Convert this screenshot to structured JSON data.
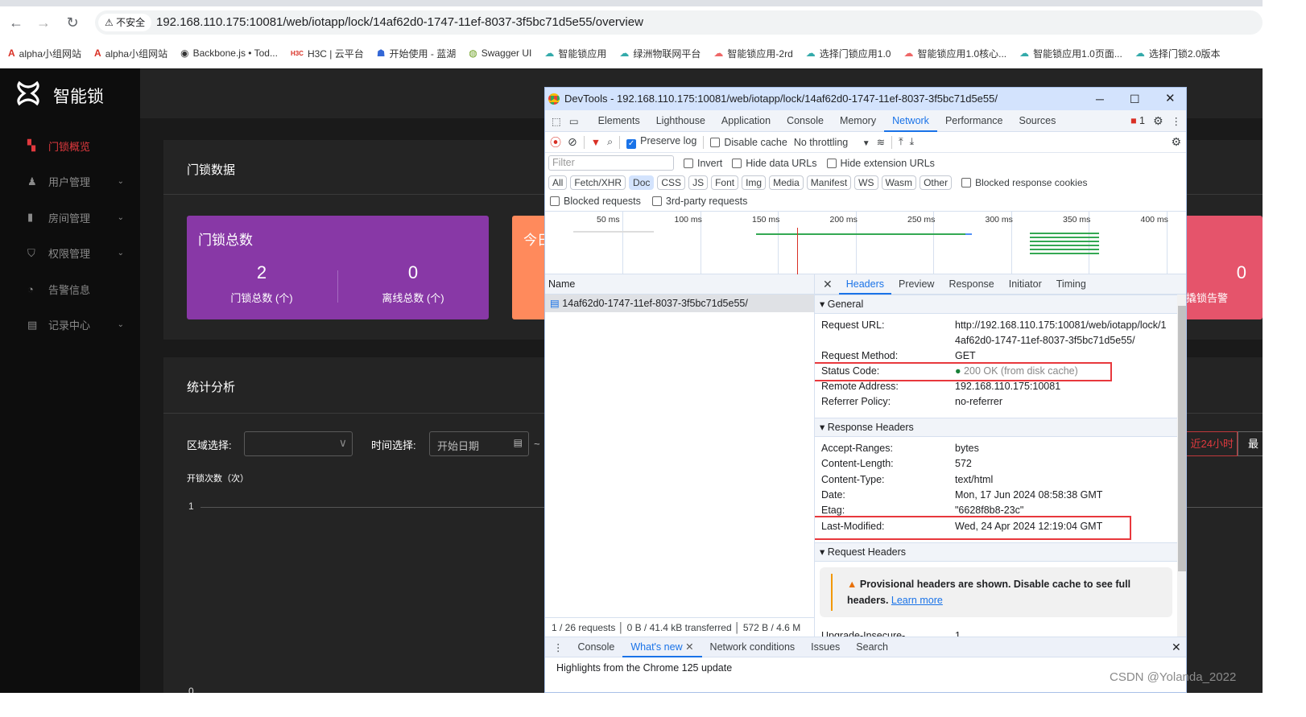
{
  "browser": {
    "insecure_label": "不安全",
    "url": "192.168.110.175:10081/web/iotapp/lock/14af62d0-1747-11ef-8037-3f5bc71d5e55/overview",
    "bookmarks": [
      "alpha小组网站",
      "alpha小组网站",
      "Backbone.js • Tod...",
      "H3C | 云平台",
      "开始使用 - 蓝湖",
      "Swagger UI",
      "智能锁应用",
      "绿洲物联网平台",
      "智能锁应用-2rd",
      "选择门锁应用1.0",
      "智能锁应用1.0核心...",
      "智能锁应用1.0页面...",
      "选择门锁2.0版本"
    ]
  },
  "app": {
    "name": "智能锁",
    "sidebar": [
      {
        "label": "门锁概览",
        "icon": "dashboard-icon",
        "active": true
      },
      {
        "label": "用户管理",
        "icon": "user-icon",
        "expandable": true
      },
      {
        "label": "房间管理",
        "icon": "door-icon",
        "expandable": true
      },
      {
        "label": "权限管理",
        "icon": "shield-icon",
        "expandable": true
      },
      {
        "label": "告警信息",
        "icon": "gauge-icon"
      },
      {
        "label": "记录中心",
        "icon": "document-icon",
        "expandable": true
      }
    ],
    "lock_data": {
      "title": "门锁数据",
      "card_title": "门锁总数",
      "total": "2",
      "total_label": "门锁总数 (个)",
      "offline": "0",
      "offline_label": "离线总数 (个)",
      "orange_card_title": "今日",
      "red_value": "0",
      "red_label": "撬锁告警"
    },
    "stats": {
      "title": "统计分析",
      "region_label": "区域选择:",
      "region_value": "",
      "time_label": "时间选择:",
      "start_placeholder": "开始日期",
      "range_sep": "~",
      "btn_24h": "近24小时",
      "btn_recent": "最",
      "chart_ylabel": "开锁次数（次）",
      "tick_1": "1",
      "tick_0": "0"
    },
    "colors": {
      "purple": "#8838a6",
      "orange": "#ff8a5c",
      "red": "#e5546b",
      "accent": "#e0393e"
    }
  },
  "devtools": {
    "title": "DevTools - 192.168.110.175:10081/web/iotapp/lock/14af62d0-1747-11ef-8037-3f5bc71d5e55/",
    "tabs": [
      "Elements",
      "Lighthouse",
      "Application",
      "Console",
      "Memory",
      "Network",
      "Performance",
      "Sources"
    ],
    "selected_tab": "Network",
    "issues_count": "1",
    "toolbar": {
      "preserve_log": "Preserve log",
      "preserve_log_checked": true,
      "disable_cache": "Disable cache",
      "throttling": "No throttling"
    },
    "filter": {
      "placeholder": "Filter",
      "invert": "Invert",
      "hide_data_urls": "Hide data URLs",
      "hide_ext_urls": "Hide extension URLs"
    },
    "types": [
      "All",
      "Fetch/XHR",
      "Doc",
      "CSS",
      "JS",
      "Font",
      "Img",
      "Media",
      "Manifest",
      "WS",
      "Wasm",
      "Other"
    ],
    "selected_type": "Doc",
    "blocked_cookies": "Blocked response cookies",
    "blocked_requests": "Blocked requests",
    "third_party": "3rd-party requests",
    "timeline_ticks": [
      "50 ms",
      "100 ms",
      "150 ms",
      "200 ms",
      "250 ms",
      "300 ms",
      "350 ms",
      "400 ms"
    ],
    "name_header": "Name",
    "request_name": "14af62d0-1747-11ef-8037-3f5bc71d5e55/",
    "footer": {
      "requests": "1 / 26 requests",
      "transferred": "0 B / 41.4 kB transferred",
      "resources": "572 B / 4.6 M"
    },
    "detail_tabs": [
      "Headers",
      "Preview",
      "Response",
      "Initiator",
      "Timing"
    ],
    "general": {
      "title": "General",
      "rows": [
        [
          "Request URL:",
          "http://192.168.110.175:10081/web/iotapp/lock/14af62d0-1747-11ef-8037-3f5bc71d5e55/"
        ],
        [
          "Request Method:",
          "GET"
        ],
        [
          "Status Code:",
          "200 OK (from disk cache)"
        ],
        [
          "Remote Address:",
          "192.168.110.175:10081"
        ],
        [
          "Referrer Policy:",
          "no-referrer"
        ]
      ]
    },
    "url_line1": "http://192.168.110.175:10081/web/iotapp/lock/1",
    "url_line2": "4af62d0-1747-11ef-8037-3f5bc71d5e55/",
    "response_headers": {
      "title": "Response Headers",
      "rows": [
        [
          "Accept-Ranges:",
          "bytes"
        ],
        [
          "Content-Length:",
          "572"
        ],
        [
          "Content-Type:",
          "text/html"
        ],
        [
          "Date:",
          "Mon, 17 Jun 2024 08:58:38 GMT"
        ],
        [
          "Etag:",
          "\"6628f8b8-23c\""
        ],
        [
          "Last-Modified:",
          "Wed, 24 Apr 2024 12:19:04 GMT"
        ]
      ]
    },
    "request_headers": {
      "title": "Request Headers",
      "warning": "Provisional headers are shown. Disable cache to see full",
      "warning2": "headers.",
      "learn_more": "Learn more",
      "rows": [
        [
          "Upgrade-Insecure-",
          "1"
        ]
      ]
    },
    "drawer_tabs": [
      "Console",
      "What's new",
      "Network conditions",
      "Issues",
      "Search"
    ],
    "drawer_selected": "What's new",
    "drawer_text": "Highlights from the Chrome 125 update"
  },
  "watermark": "CSDN @Yolanda_2022"
}
